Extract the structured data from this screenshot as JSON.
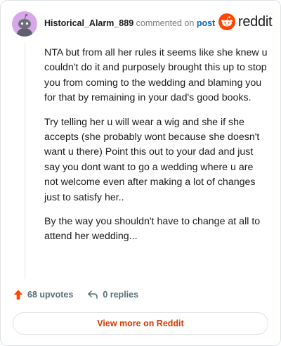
{
  "comment": {
    "author": "Historical_Alarm_889",
    "action_text": "commented on",
    "target_link": "post",
    "paragraphs": [
      "NTA but from all her rules it seems like she knew u couldn't do it and purposely brought this up to stop you from coming to the wedding and blaming you for that by remaining in your dad's good books.",
      "Try telling her u will wear a wig and she if she accepts (she probably wont because she doesn't want u there) Point this out to your dad and just say you dont want to go a wedding where u are not welcome even after making a lot of changes just to satisfy her..",
      "By the way you shouldn't have to change at all to attend her wedding..."
    ]
  },
  "brand": {
    "wordmark": "reddit",
    "icon": "reddit-snoo-icon",
    "color": "#ff4500"
  },
  "actions": {
    "upvotes_label": "68 upvotes",
    "upvote_icon": "upvote-arrow-icon",
    "upvote_color": "#ff4500",
    "replies_label": "0 replies",
    "reply_icon": "reply-arrow-icon"
  },
  "footer": {
    "view_more_label": "View more on Reddit",
    "accent_color": "#d93a00"
  },
  "avatar": {
    "icon": "snoo-avatar-icon",
    "background_color": "#d7a8e8"
  }
}
